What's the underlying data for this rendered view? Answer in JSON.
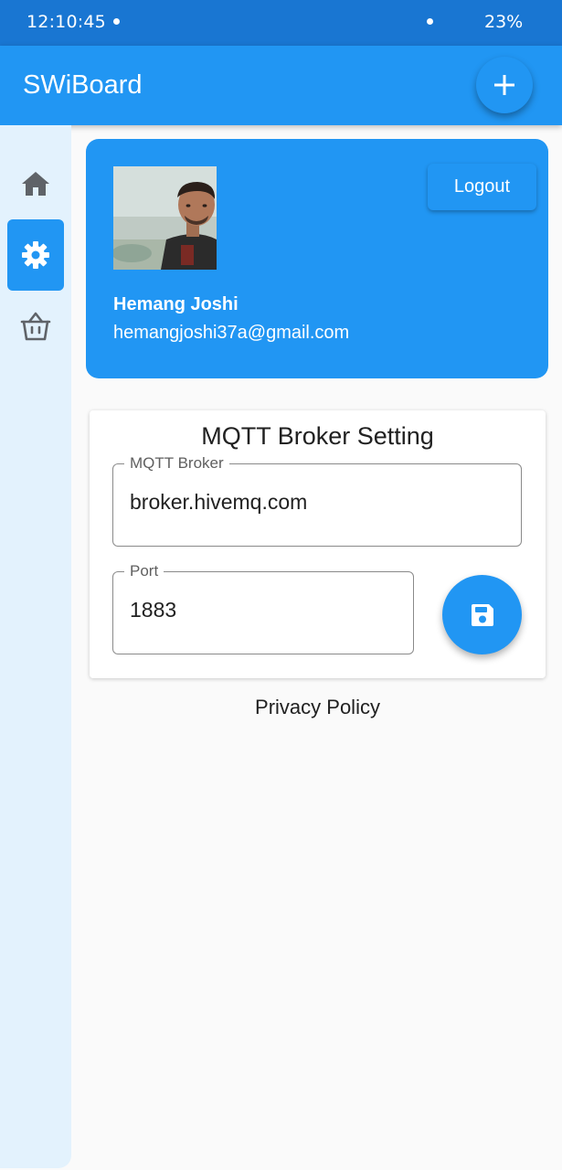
{
  "status_bar": {
    "time": "12:10:45",
    "battery": "23%"
  },
  "app_bar": {
    "title": "SWiBoard",
    "add_icon": "plus-icon"
  },
  "colors": {
    "primary": "#2196f3",
    "primary_dark": "#1976d2",
    "rail_bg": "#e3f2fd"
  },
  "nav_rail": {
    "items": [
      {
        "icon": "home-icon",
        "active": false
      },
      {
        "icon": "gear-icon",
        "active": true
      },
      {
        "icon": "basket-icon",
        "active": false
      }
    ]
  },
  "profile": {
    "name": "Hemang Joshi",
    "email": "hemangjoshi37a@gmail.com",
    "logout_label": "Logout"
  },
  "mqtt": {
    "title": "MQTT Broker Setting",
    "broker_label": "MQTT Broker",
    "broker_value": "broker.hivemq.com",
    "port_label": "Port",
    "port_value": "1883",
    "save_icon": "floppy-disk-icon"
  },
  "footer": {
    "privacy_label": "Privacy Policy"
  }
}
